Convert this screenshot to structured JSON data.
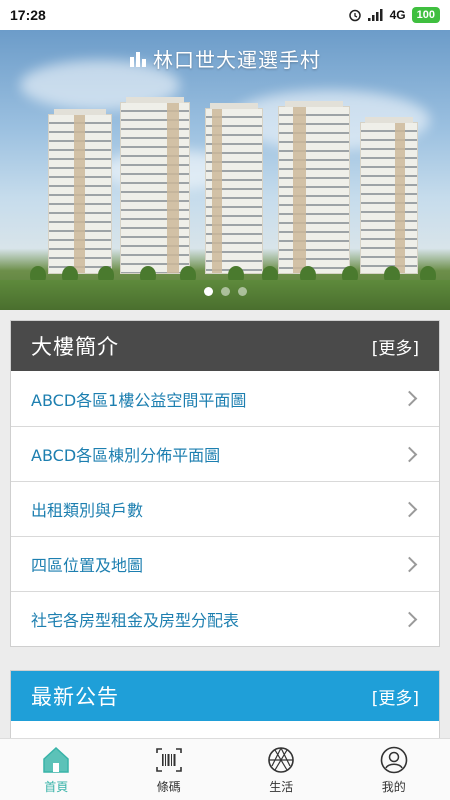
{
  "status_bar": {
    "time": "17:28",
    "network": "4G",
    "battery": "100"
  },
  "banner": {
    "title": "林口世大運選手村",
    "slides": 3,
    "active_slide": 1
  },
  "building_intro": {
    "title": "大樓簡介",
    "more_label": "[更多]",
    "items": [
      {
        "label": "ABCD各區1樓公益空間平面圖"
      },
      {
        "label": "ABCD各區棟別分佈平面圖"
      },
      {
        "label": "出租類別與戶數"
      },
      {
        "label": "四區位置及地圖"
      },
      {
        "label": "社宅各房型租金及房型分配表"
      }
    ]
  },
  "news": {
    "title": "最新公告",
    "more_label": "[更多]"
  },
  "bottom_nav": {
    "items": [
      {
        "label": "首頁",
        "icon": "home-icon",
        "active": true
      },
      {
        "label": "條碼",
        "icon": "barcode-icon",
        "active": false
      },
      {
        "label": "生活",
        "icon": "aperture-icon",
        "active": false
      },
      {
        "label": "我的",
        "icon": "user-icon",
        "active": false
      }
    ]
  },
  "colors": {
    "accent": "#38b3a8",
    "link": "#1d7fb0",
    "dark_header": "#4a4a4a",
    "blue_header": "#1f9fd8"
  }
}
